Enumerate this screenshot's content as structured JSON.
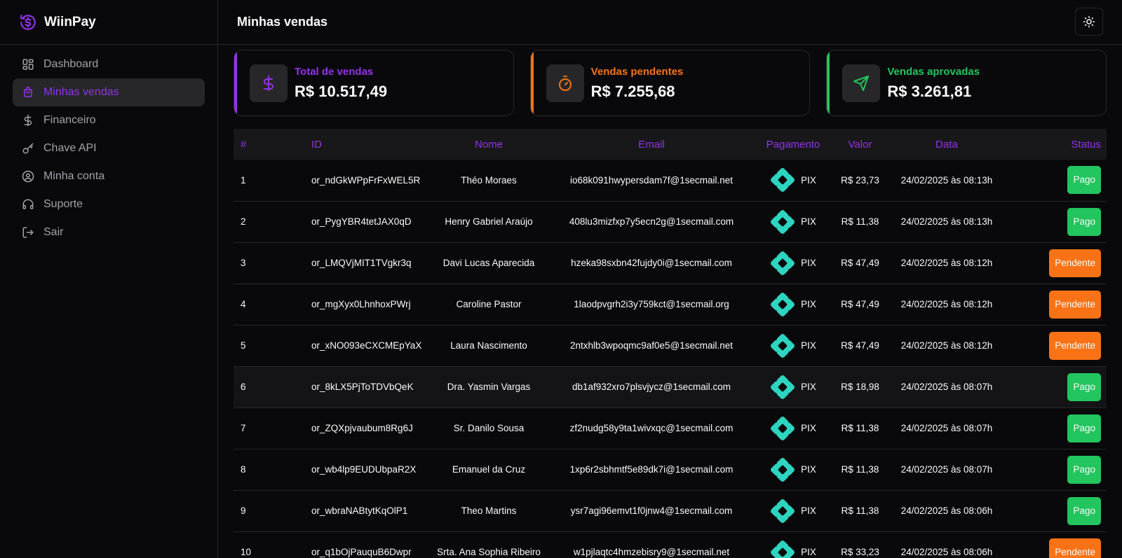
{
  "brand": {
    "name": "WiinPay"
  },
  "header": {
    "title": "Minhas vendas"
  },
  "nav": [
    {
      "label": "Dashboard",
      "icon": "dashboard-icon",
      "active": false
    },
    {
      "label": "Minhas vendas",
      "icon": "shopping-bag-icon",
      "active": true
    },
    {
      "label": "Financeiro",
      "icon": "dollar-icon",
      "active": false
    },
    {
      "label": "Chave API",
      "icon": "key-icon",
      "active": false
    },
    {
      "label": "Minha conta",
      "icon": "user-circle-icon",
      "active": false
    },
    {
      "label": "Suporte",
      "icon": "headset-icon",
      "active": false
    },
    {
      "label": "Sair",
      "icon": "logout-icon",
      "active": false
    }
  ],
  "cards": [
    {
      "label": "Total de vendas",
      "value": "R$ 10.517,49",
      "color": "#9333ea",
      "icon": "dollar-icon"
    },
    {
      "label": "Vendas pendentes",
      "value": "R$ 7.255,68",
      "color": "#f97316",
      "icon": "timer-icon"
    },
    {
      "label": "Vendas aprovadas",
      "value": "R$ 3.261,81",
      "color": "#22c55e",
      "icon": "send-icon"
    }
  ],
  "table": {
    "columns": [
      "#",
      "ID",
      "Nome",
      "Email",
      "Pagamento",
      "Valor",
      "Data",
      "Status"
    ],
    "rows": [
      {
        "num": "1",
        "id": "or_ndGkWPpFrFxWEL5R",
        "nome": "Théo Moraes",
        "email": "io68k091hwypersdam7f@1secmail.net",
        "pagamento": "PIX",
        "valor": "R$ 23,73",
        "data": "24/02/2025 às 08:13h",
        "status": "Pago"
      },
      {
        "num": "2",
        "id": "or_PygYBR4tetJAX0qD",
        "nome": "Henry Gabriel Araújo",
        "email": "408lu3mizfxp7y5ecn2g@1secmail.com",
        "pagamento": "PIX",
        "valor": "R$ 11,38",
        "data": "24/02/2025 às 08:13h",
        "status": "Pago"
      },
      {
        "num": "3",
        "id": "or_LMQVjMIT1TVgkr3q",
        "nome": "Davi Lucas Aparecida",
        "email": "hzeka98sxbn42fujdy0i@1secmail.com",
        "pagamento": "PIX",
        "valor": "R$ 47,49",
        "data": "24/02/2025 às 08:12h",
        "status": "Pendente"
      },
      {
        "num": "4",
        "id": "or_mgXyx0LhnhoxPWrj",
        "nome": "Caroline Pastor",
        "email": "1laodpvgrh2i3y759kct@1secmail.org",
        "pagamento": "PIX",
        "valor": "R$ 47,49",
        "data": "24/02/2025 às 08:12h",
        "status": "Pendente"
      },
      {
        "num": "5",
        "id": "or_xNO093eCXCMEpYaX",
        "nome": "Laura Nascimento",
        "email": "2ntxhlb3wpoqmc9af0e5@1secmail.net",
        "pagamento": "PIX",
        "valor": "R$ 47,49",
        "data": "24/02/2025 às 08:12h",
        "status": "Pendente"
      },
      {
        "num": "6",
        "id": "or_8kLX5PjToTDVbQeK",
        "nome": "Dra. Yasmin Vargas",
        "email": "db1af932xro7plsvjycz@1secmail.com",
        "pagamento": "PIX",
        "valor": "R$ 18,98",
        "data": "24/02/2025 às 08:07h",
        "status": "Pago"
      },
      {
        "num": "7",
        "id": "or_ZQXpjvaubum8Rg6J",
        "nome": "Sr. Danilo Sousa",
        "email": "zf2nudg58y9ta1wivxqc@1secmail.com",
        "pagamento": "PIX",
        "valor": "R$ 11,38",
        "data": "24/02/2025 às 08:07h",
        "status": "Pago"
      },
      {
        "num": "8",
        "id": "or_wb4lp9EUDUbpaR2X",
        "nome": "Emanuel da Cruz",
        "email": "1xp6r2sbhmtf5e89dk7i@1secmail.com",
        "pagamento": "PIX",
        "valor": "R$ 11,38",
        "data": "24/02/2025 às 08:07h",
        "status": "Pago"
      },
      {
        "num": "9",
        "id": "or_wbraNABtytKqOlP1",
        "nome": "Theo Martins",
        "email": "ysr7agi96emvt1f0jnw4@1secmail.com",
        "pagamento": "PIX",
        "valor": "R$ 11,38",
        "data": "24/02/2025 às 08:06h",
        "status": "Pago"
      },
      {
        "num": "10",
        "id": "or_q1bOjPauquB6Dwpr",
        "nome": "Srta. Ana Sophia Ribeiro",
        "email": "w1pjlaqtc4hmzebisry9@1secmail.net",
        "pagamento": "PIX",
        "valor": "R$ 33,23",
        "data": "24/02/2025 às 08:06h",
        "status": "Pendente"
      }
    ]
  }
}
